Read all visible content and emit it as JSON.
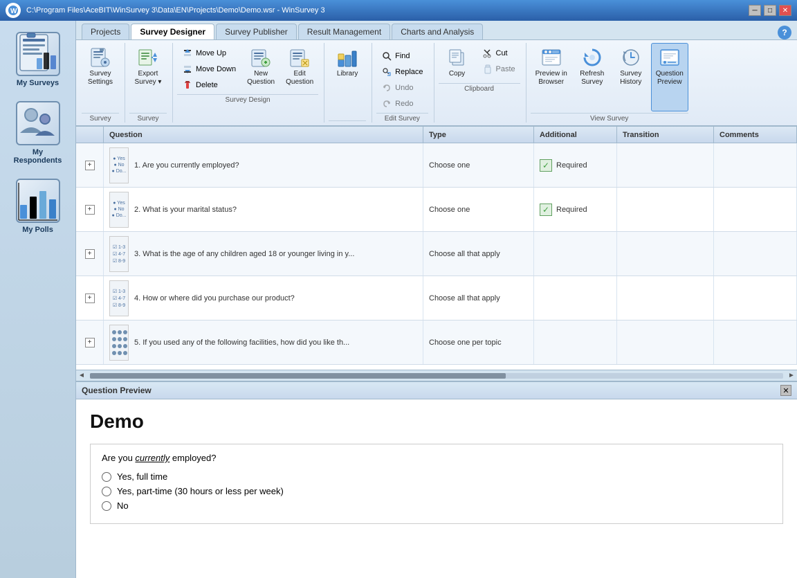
{
  "window": {
    "title": "C:\\Program Files\\AceBIT\\WinSurvey 3\\Data\\EN\\Projects\\Demo\\Demo.wsr - WinSurvey 3",
    "controls": [
      "minimize",
      "restore",
      "close"
    ]
  },
  "tabs": [
    {
      "id": "projects",
      "label": "Projects"
    },
    {
      "id": "survey-designer",
      "label": "Survey Designer",
      "active": true
    },
    {
      "id": "survey-publisher",
      "label": "Survey Publisher"
    },
    {
      "id": "result-management",
      "label": "Result Management"
    },
    {
      "id": "charts-analysis",
      "label": "Charts and Analysis"
    }
  ],
  "ribbon": {
    "groups": [
      {
        "id": "survey",
        "label": "Survey",
        "buttons": [
          {
            "id": "survey-settings",
            "label": "Survey\nSettings",
            "icon": "survey-settings-icon"
          }
        ]
      },
      {
        "id": "export-survey",
        "label": "Survey",
        "buttons": [
          {
            "id": "export-survey",
            "label": "Export\nSurvey",
            "icon": "export-icon",
            "hasArrow": true
          }
        ]
      },
      {
        "id": "survey-design",
        "label": "Survey Design",
        "buttons": [
          {
            "id": "new-question",
            "label": "New\nQuestion",
            "icon": "new-question-icon"
          },
          {
            "id": "edit-question",
            "label": "Edit\nQuestion",
            "icon": "edit-question-icon"
          }
        ],
        "smallButtons": [
          {
            "id": "move-up",
            "label": "Move Up",
            "icon": "move-up-icon"
          },
          {
            "id": "move-down",
            "label": "Move Down",
            "icon": "move-down-icon"
          },
          {
            "id": "delete",
            "label": "Delete",
            "icon": "delete-icon"
          }
        ]
      },
      {
        "id": "library-group",
        "label": "",
        "buttons": [
          {
            "id": "library",
            "label": "Library",
            "icon": "library-icon"
          }
        ]
      },
      {
        "id": "edit-survey",
        "label": "Edit Survey",
        "smallButtons": [
          {
            "id": "find",
            "label": "Find",
            "icon": "find-icon"
          },
          {
            "id": "replace",
            "label": "Replace",
            "icon": "replace-icon"
          },
          {
            "id": "undo",
            "label": "Undo",
            "icon": "undo-icon",
            "disabled": true
          },
          {
            "id": "redo",
            "label": "Redo",
            "icon": "redo-icon",
            "disabled": true
          }
        ]
      },
      {
        "id": "clipboard",
        "label": "Clipboard",
        "buttons": [
          {
            "id": "copy",
            "label": "Copy",
            "icon": "copy-icon"
          }
        ],
        "smallButtons": [
          {
            "id": "cut",
            "label": "Cut",
            "icon": "cut-icon"
          },
          {
            "id": "paste",
            "label": "Paste",
            "icon": "paste-icon",
            "disabled": true
          }
        ]
      },
      {
        "id": "view-survey",
        "label": "View Survey",
        "buttons": [
          {
            "id": "preview-browser",
            "label": "Preview in\nBrowser",
            "icon": "browser-icon"
          },
          {
            "id": "refresh-survey",
            "label": "Refresh\nSurvey",
            "icon": "refresh-icon"
          },
          {
            "id": "survey-history",
            "label": "Survey\nHistory",
            "icon": "history-icon"
          },
          {
            "id": "question-preview",
            "label": "Question\nPreview",
            "icon": "question-preview-icon",
            "active": true
          }
        ]
      }
    ]
  },
  "table": {
    "columns": [
      "",
      "Question",
      "Type",
      "Additional",
      "Transition",
      "Comments"
    ],
    "rows": [
      {
        "id": 1,
        "thumb": "radio",
        "question": "1. Are you currently employed?",
        "type": "Choose one",
        "additional": "Required",
        "transition": "",
        "comments": "",
        "hasCheck": true
      },
      {
        "id": 2,
        "thumb": "radio",
        "question": "2. What is your marital status?",
        "type": "Choose one",
        "additional": "Required",
        "transition": "",
        "comments": "",
        "hasCheck": true
      },
      {
        "id": 3,
        "thumb": "checkbox",
        "question": "3. What is the age of any children aged 18 or younger living in y...",
        "type": "Choose all that apply",
        "additional": "",
        "transition": "",
        "comments": ""
      },
      {
        "id": 4,
        "thumb": "checkbox",
        "question": "4. How or where did you purchase our product?",
        "type": "Choose all that apply",
        "additional": "",
        "transition": "",
        "comments": ""
      },
      {
        "id": 5,
        "thumb": "matrix",
        "question": "5. If you used any of the following facilities, how did you like th...",
        "type": "Choose one per topic",
        "additional": "",
        "transition": "",
        "comments": ""
      }
    ]
  },
  "preview": {
    "title": "Question Preview",
    "surveyTitle": "Demo",
    "questionText": "Are you ",
    "questionItalic": "currently",
    "questionTextEnd": " employed?",
    "options": [
      "Yes, full time",
      "Yes, part-time (30 hours or less per week)",
      "No"
    ]
  },
  "sidebar": {
    "items": [
      {
        "id": "my-surveys",
        "label": "My Surveys"
      },
      {
        "id": "my-respondents",
        "label": "My Respondents"
      },
      {
        "id": "my-polls",
        "label": "My Polls"
      }
    ]
  }
}
